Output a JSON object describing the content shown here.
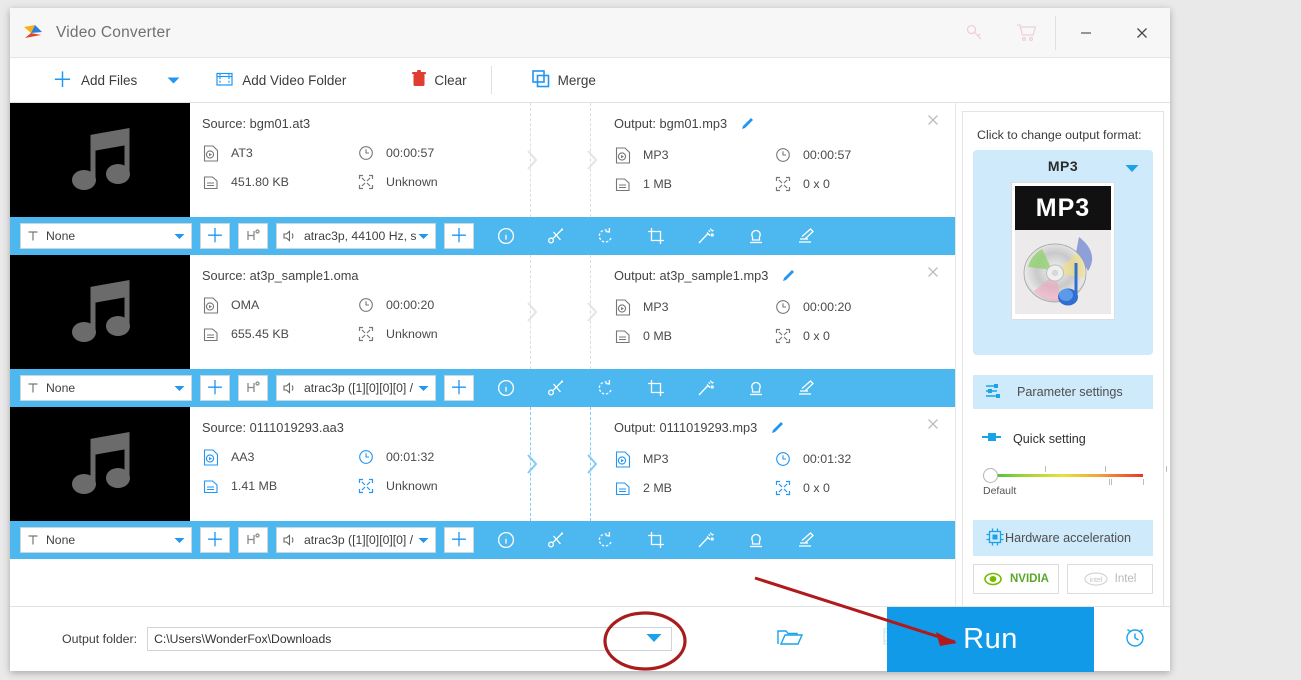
{
  "window": {
    "title": "Video Converter",
    "icons": {
      "key": "key-icon",
      "cart": "cart-icon",
      "minimize": "−",
      "close": "✕"
    }
  },
  "toolbar": {
    "add_files": "Add Files",
    "add_video_folder": "Add Video Folder",
    "clear": "Clear",
    "merge": "Merge"
  },
  "files": [
    {
      "source_label": "Source: bgm01.at3",
      "source_format": "AT3",
      "source_duration": "00:00:57",
      "source_size": "451.80 KB",
      "source_resolution": "Unknown",
      "output_label": "Output: bgm01.mp3",
      "output_format": "MP3",
      "output_duration": "00:00:57",
      "output_size": "1 MB",
      "output_resolution": "0 x 0",
      "subtitle": "None",
      "audio": "atrac3p, 44100 Hz, s",
      "selected": false
    },
    {
      "source_label": "Source: at3p_sample1.oma",
      "source_format": "OMA",
      "source_duration": "00:00:20",
      "source_size": "655.45 KB",
      "source_resolution": "Unknown",
      "output_label": "Output: at3p_sample1.mp3",
      "output_format": "MP3",
      "output_duration": "00:00:20",
      "output_size": "0 MB",
      "output_resolution": "0 x 0",
      "subtitle": "None",
      "audio": "atrac3p ([1][0][0][0] /",
      "selected": false
    },
    {
      "source_label": "Source: 0111019293.aa3",
      "source_format": "AA3",
      "source_duration": "00:01:32",
      "source_size": "1.41 MB",
      "source_resolution": "Unknown",
      "output_label": "Output: 0111019293.mp3",
      "output_format": "MP3",
      "output_duration": "00:01:32",
      "output_size": "2 MB",
      "output_resolution": "0 x 0",
      "subtitle": "None",
      "audio": "atrac3p ([1][0][0][0] /",
      "selected": true
    }
  ],
  "strip_tools": [
    "info-icon",
    "cut-icon",
    "rotate-icon",
    "crop-icon",
    "effect-icon",
    "watermark-icon",
    "subtitle-icon"
  ],
  "right_panel": {
    "prompt": "Click to change output format:",
    "format_name": "MP3",
    "format_badge": "MP3",
    "parameter_settings": "Parameter settings",
    "quick_setting": "Quick setting",
    "slider_default_label": "Default",
    "hardware_acceleration": "Hardware acceleration",
    "gpu_nvidia": "NVIDIA",
    "gpu_intel": "Intel"
  },
  "bottom": {
    "output_folder_label": "Output folder:",
    "output_folder_value": "C:\\Users\\WonderFox\\Downloads",
    "run_label": "Run"
  },
  "colors": {
    "accent": "#109ae8",
    "strip": "#4db8f0",
    "panel_highlight": "#cfeafb",
    "annotation_red": "#b01a1a"
  }
}
